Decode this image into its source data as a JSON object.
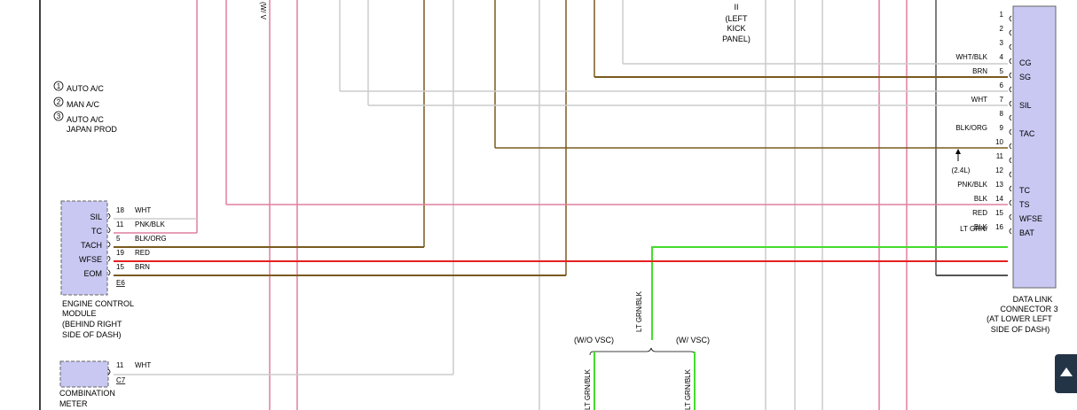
{
  "notes": [
    {
      "num": "1",
      "label": "AUTO A/C"
    },
    {
      "num": "2",
      "label": "MAN A/C"
    },
    {
      "num": "3",
      "label": "AUTO A/C",
      "label2": "JAPAN PROD"
    }
  ],
  "top_cutoff_label": "(W/ V",
  "kick_panel": {
    "line0": "II",
    "line1": "(LEFT",
    "line2": "KICK",
    "line3": "PANEL)"
  },
  "ecm": {
    "pins": [
      {
        "name": "SIL",
        "num": "18",
        "wire": "WHT"
      },
      {
        "name": "TC",
        "num": "11",
        "wire": "PNK/BLK"
      },
      {
        "name": "TACH",
        "num": "5",
        "wire": "BLK/ORG"
      },
      {
        "name": "WFSE",
        "num": "19",
        "wire": "RED"
      },
      {
        "name": "EOM",
        "num": "15",
        "wire": "BRN"
      }
    ],
    "connector": "E6",
    "label": [
      "ENGINE CONTROL",
      "MODULE",
      "(BEHIND RIGHT",
      "SIDE OF DASH)"
    ]
  },
  "meter": {
    "pin_num": "11",
    "wire": "WHT",
    "connector": "C7",
    "label": [
      "COMBINATION",
      "METER"
    ]
  },
  "dlc": {
    "pins": [
      {
        "num": "1",
        "wire": "",
        "name": ""
      },
      {
        "num": "2",
        "wire": "",
        "name": ""
      },
      {
        "num": "3",
        "wire": "",
        "name": ""
      },
      {
        "num": "4",
        "wire": "WHT/BLK",
        "name": "CG"
      },
      {
        "num": "5",
        "wire": "BRN",
        "name": "SG"
      },
      {
        "num": "6",
        "wire": "",
        "name": ""
      },
      {
        "num": "7",
        "wire": "WHT",
        "name": "SIL"
      },
      {
        "num": "8",
        "wire": "",
        "name": ""
      },
      {
        "num": "9",
        "wire": "BLK/ORG",
        "name": "TAC"
      },
      {
        "num": "10",
        "wire": "",
        "name": ""
      },
      {
        "num": "11",
        "wire": "",
        "name": ""
      },
      {
        "num": "12",
        "wire": "",
        "name": ""
      },
      {
        "num": "13",
        "wire": "PNK/BLK",
        "name": "TC"
      },
      {
        "num": "14",
        "wire": "BLK",
        "name": "TS"
      },
      {
        "num": "15",
        "wire": "RED",
        "name": "WFSE"
      },
      {
        "num": "16",
        "wire": "BLK",
        "name": "BAT"
      }
    ],
    "lt_grn_prefix": "LT GRN/",
    "engine_note": "(2.4L)",
    "label": [
      "DATA LINK",
      "CONNECTOR 3",
      "(AT LOWER LEFT",
      "SIDE OF DASH)"
    ]
  },
  "vsc": {
    "main_wire": "LT GRN/BLK",
    "wo_vsc": "(W/O VSC)",
    "w_vsc": "(W/ VSC)",
    "left_wire": "LT GRN/BLK",
    "right_wire": "LT GRN/BLK"
  },
  "colors": {
    "brown": "#7a5a1e",
    "pink": "#e07f9e",
    "gray": "#cccccc",
    "red": "#e52020",
    "green": "#44dd2e",
    "connector_fill": "#c8c8f2",
    "dark": "#666666"
  }
}
